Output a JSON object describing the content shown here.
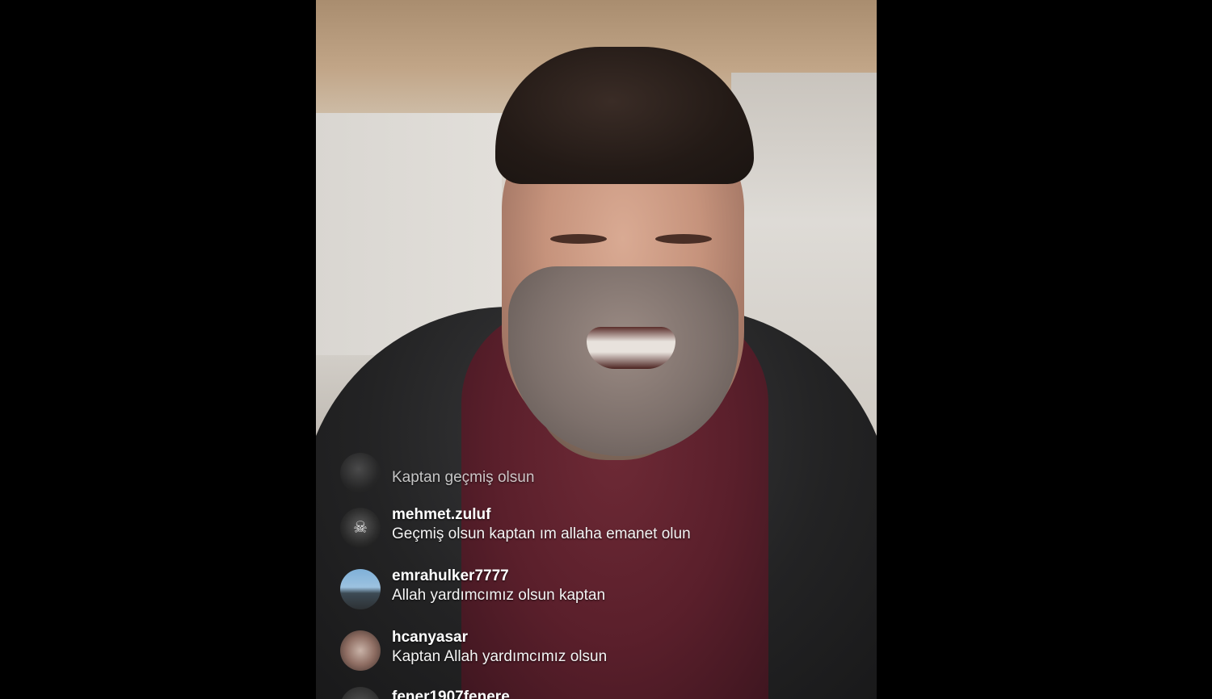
{
  "comments": [
    {
      "username": "",
      "message": "Kaptan geçmiş olsun",
      "avatar_icon": "dark-profile-avatar",
      "faded": true
    },
    {
      "username": "mehmet.zuluf",
      "message": "Geçmiş olsun kaptan ım allaha emanet olun",
      "avatar_icon": "dark-profile-avatar"
    },
    {
      "username": "emrahulker7777",
      "message": "Allah yardımcımız olsun kaptan",
      "avatar_icon": "sky-photo-avatar"
    },
    {
      "username": "hcanyasar",
      "message": "Kaptan Allah yardımcımız olsun",
      "avatar_icon": "group-photo-avatar"
    },
    {
      "username": "fener1907fenere",
      "message": "",
      "avatar_icon": "dark-profile-avatar"
    }
  ]
}
